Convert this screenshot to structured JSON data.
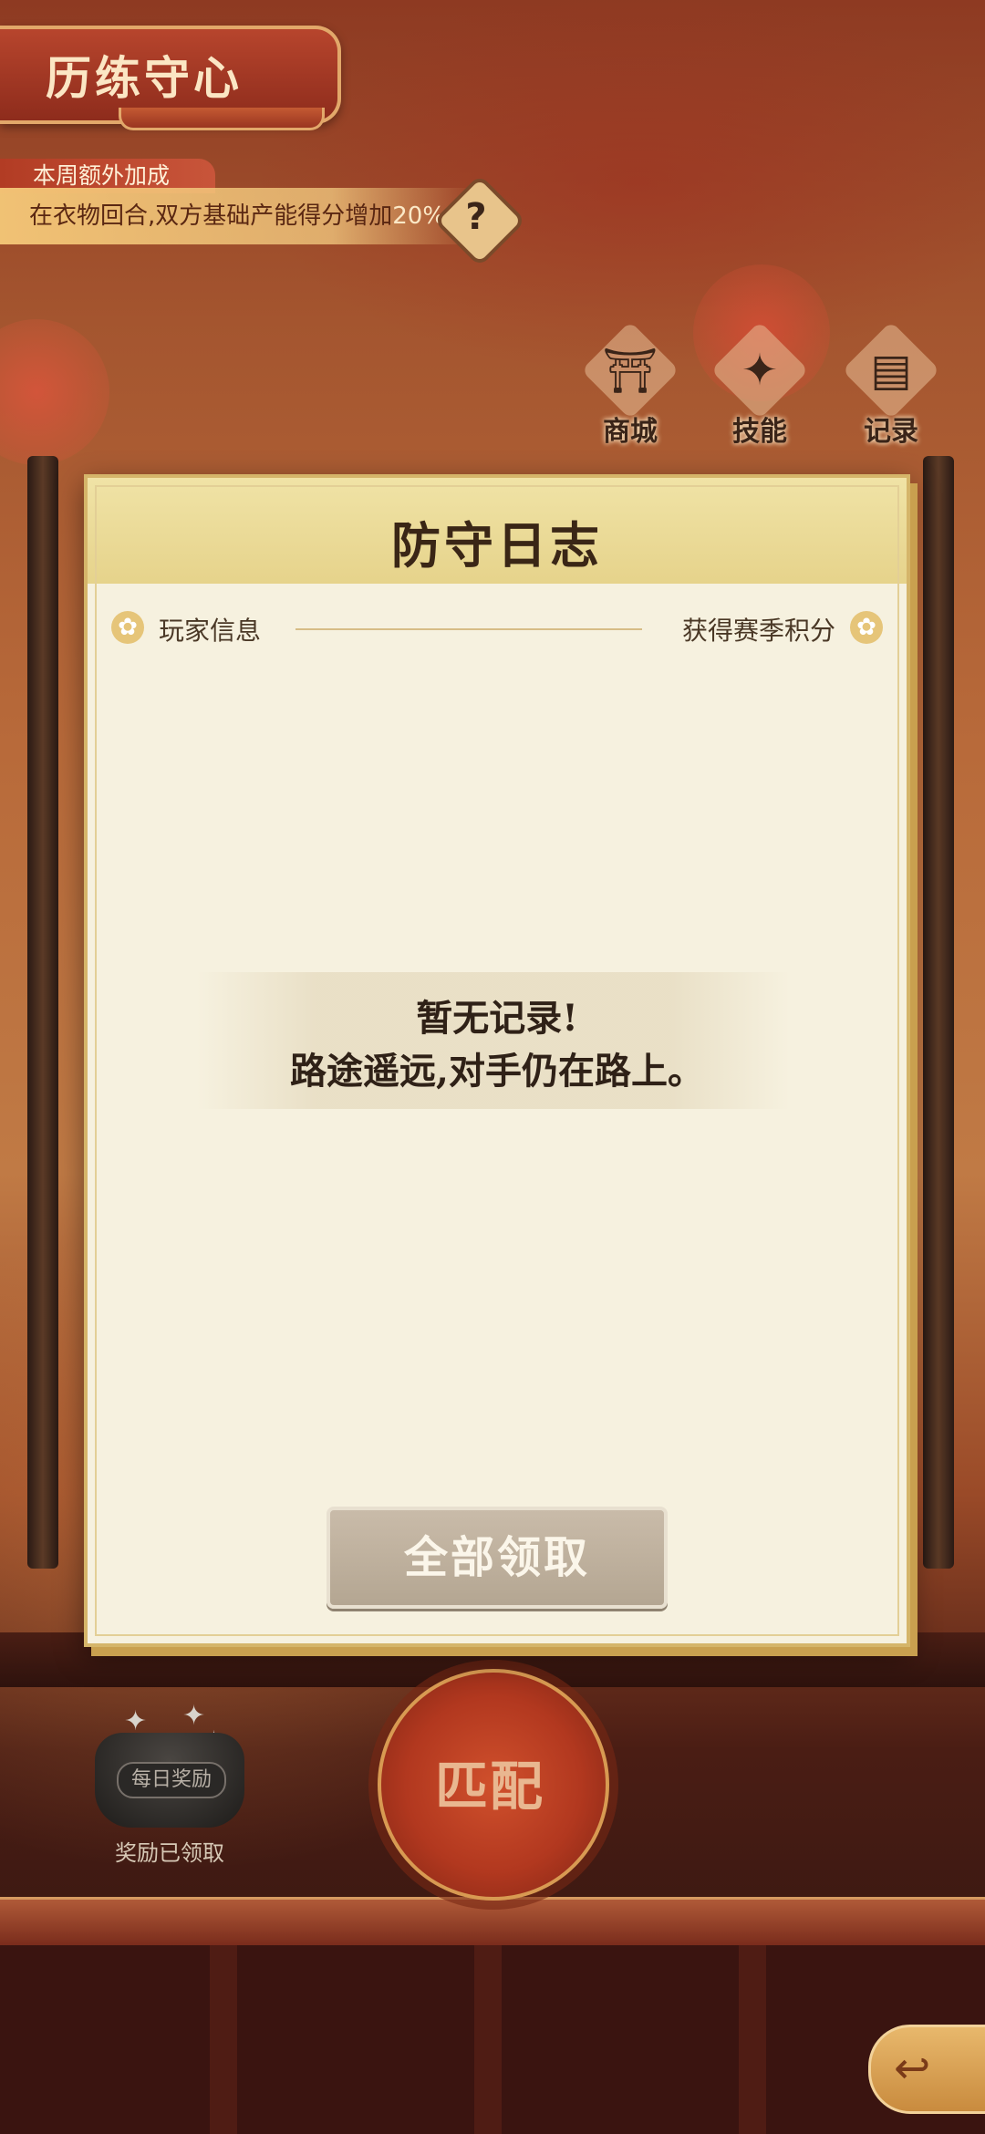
{
  "header": {
    "title": "历练守心",
    "bonus_label": "本周额外加成",
    "bonus_text": "在衣物回合,双方基础产能得分增加",
    "bonus_percent": "20%",
    "help_label": "?"
  },
  "top_actions": [
    {
      "label": "商城",
      "icon": "shop-icon"
    },
    {
      "label": "技能",
      "icon": "skill-icon"
    },
    {
      "label": "记录",
      "icon": "record-icon"
    }
  ],
  "modal": {
    "title": "防守日志",
    "column_left": "玩家信息",
    "column_right": "获得赛季积分",
    "empty_line1": "暂无记录!",
    "empty_line2": "路途遥远,对手仍在路上。",
    "claim_all_button": "全部领取"
  },
  "bottom": {
    "daily_reward_label": "每日奖励",
    "daily_reward_status": "奖励已领取",
    "match_button": "匹配"
  },
  "colors": {
    "accent_gold": "#d5b56a",
    "modal_bg": "#f6f1df",
    "header_red": "#b7452d",
    "match_red": "#c9482a"
  }
}
